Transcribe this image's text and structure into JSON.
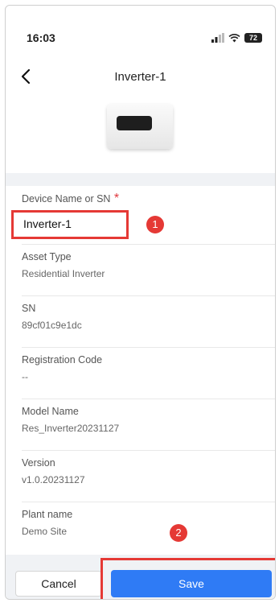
{
  "status_bar": {
    "time": "16:03",
    "battery": "72"
  },
  "header": {
    "title": "Inverter-1"
  },
  "form": {
    "name_field": {
      "label": "Device Name or SN",
      "required_mark": "*",
      "value": "Inverter-1"
    },
    "fields": [
      {
        "label": "Asset Type",
        "value": "Residential Inverter"
      },
      {
        "label": "SN",
        "value": "89cf01c9e1dc"
      },
      {
        "label": "Registration Code",
        "value": "--"
      },
      {
        "label": "Model Name",
        "value": "Res_Inverter20231127"
      },
      {
        "label": "Version",
        "value": "v1.0.20231127"
      },
      {
        "label": "Plant name",
        "value": "Demo Site"
      }
    ]
  },
  "annotations": {
    "marker_1": "1",
    "marker_2": "2",
    "color": "#e53935"
  },
  "footer": {
    "cancel_label": "Cancel",
    "save_label": "Save"
  },
  "colors": {
    "accent": "#2f7bf5",
    "background_band": "#f0f2f5"
  },
  "icons": {
    "back": "chevron-left-icon",
    "signal": "signal-icon",
    "wifi": "wifi-icon",
    "battery": "battery-icon"
  }
}
